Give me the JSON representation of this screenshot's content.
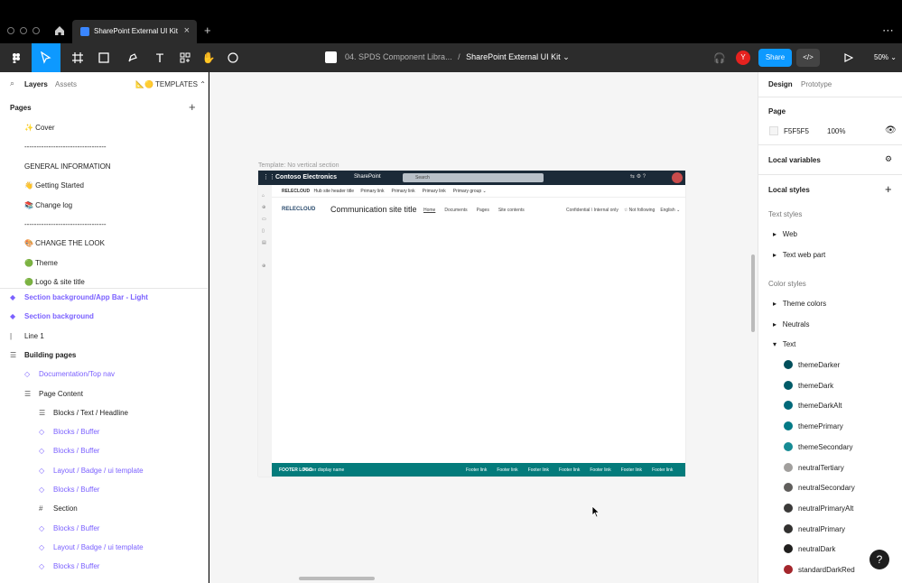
{
  "browser": {
    "tab_title": "SharePoint External UI Kit",
    "new_tab": "+",
    "close": "×",
    "more": "⋯"
  },
  "toolbar": {
    "breadcrumb_project": "04. SPDS Component Libra...",
    "breadcrumb_sep": "/",
    "breadcrumb_file": "SharePoint External UI Kit",
    "avatar": "Y",
    "share_label": "Share",
    "dev_label": "</>",
    "zoom": "50%"
  },
  "left": {
    "tab_layers": "Layers",
    "tab_assets": "Assets",
    "templates": "TEMPLATES",
    "pages_header": "Pages",
    "pages": [
      {
        "label": "✨ Cover"
      },
      {
        "label": "----------------------------------"
      },
      {
        "label": "GENERAL INFORMATION"
      },
      {
        "label": "👋 Getting Started"
      },
      {
        "label": "📚 Change log"
      },
      {
        "label": "----------------------------------"
      },
      {
        "label": "🎨 CHANGE THE LOOK"
      },
      {
        "label": "🟢 Theme"
      },
      {
        "label": "🟢 Logo & site title"
      }
    ],
    "layers": [
      {
        "label": "Section background/App Bar - Light",
        "color": "#7b61ff",
        "bold": true,
        "indent": 0,
        "icon": "◆"
      },
      {
        "label": "Section background",
        "color": "#7b61ff",
        "bold": true,
        "indent": 0,
        "icon": "◆"
      },
      {
        "label": "Line 1",
        "color": "#1e1e1e",
        "bold": false,
        "indent": 0,
        "icon": "|"
      },
      {
        "label": "Building pages",
        "color": "#1e1e1e",
        "bold": true,
        "indent": 0,
        "icon": "☰"
      },
      {
        "label": "Documentation/Top nav",
        "color": "#7b61ff",
        "bold": false,
        "indent": 1,
        "icon": "◇"
      },
      {
        "label": "Page Content",
        "color": "#1e1e1e",
        "bold": false,
        "indent": 1,
        "icon": "☰"
      },
      {
        "label": "Blocks / Text / Headline",
        "color": "#1e1e1e",
        "bold": false,
        "indent": 2,
        "icon": "☰"
      },
      {
        "label": "Blocks / Buffer",
        "color": "#7b61ff",
        "bold": false,
        "indent": 2,
        "icon": "◇"
      },
      {
        "label": "Blocks / Buffer",
        "color": "#7b61ff",
        "bold": false,
        "indent": 2,
        "icon": "◇"
      },
      {
        "label": "Layout / Badge / ui template",
        "color": "#7b61ff",
        "bold": false,
        "indent": 2,
        "icon": "◇"
      },
      {
        "label": "Blocks / Buffer",
        "color": "#7b61ff",
        "bold": false,
        "indent": 2,
        "icon": "◇"
      },
      {
        "label": "Section",
        "color": "#1e1e1e",
        "bold": false,
        "indent": 2,
        "icon": "#"
      },
      {
        "label": "Blocks / Buffer",
        "color": "#7b61ff",
        "bold": false,
        "indent": 2,
        "icon": "◇"
      },
      {
        "label": "Layout / Badge / ui template",
        "color": "#7b61ff",
        "bold": false,
        "indent": 2,
        "icon": "◇"
      },
      {
        "label": "Blocks / Buffer",
        "color": "#7b61ff",
        "bold": false,
        "indent": 2,
        "icon": "◇"
      }
    ]
  },
  "canvas": {
    "frame_label": "Template: No vertical section",
    "sp": {
      "org": "Contoso Electronics",
      "app": "SharePoint",
      "search": "Search",
      "hub_logo": "RELECLOUD",
      "hub_title": "Hub site header title",
      "hub_links": [
        "Primary link",
        "Primary link",
        "Primary link",
        "Primary group ⌄"
      ],
      "site_logo": "RELECLOUD",
      "site_title": "Communication site title",
      "site_nav": [
        "Home",
        "Documents",
        "Pages",
        "Site contents"
      ],
      "site_meta": [
        "Confidential \\ Internal only",
        "☆ Not following",
        "English ⌄"
      ],
      "footer_logo": "FOOTER LOGO",
      "footer_name": "Footer display name",
      "footer_links": [
        "Footer link",
        "Footer link",
        "Footer link",
        "Footer link",
        "Footer link",
        "Footer link",
        "Footer link"
      ]
    }
  },
  "right": {
    "tab_design": "Design",
    "tab_prototype": "Prototype",
    "page_header": "Page",
    "page_color": "F5F5F5",
    "page_opacity": "100%",
    "local_variables": "Local variables",
    "local_styles": "Local styles",
    "text_styles": "Text styles",
    "text_style_groups": [
      "Web",
      "Text web part"
    ],
    "color_styles": "Color styles",
    "color_groups": [
      "Theme colors",
      "Neutrals"
    ],
    "text_group": "Text",
    "swatches": [
      {
        "name": "themeDarker",
        "color": "#004e5b"
      },
      {
        "name": "themeDark",
        "color": "#005b68"
      },
      {
        "name": "themeDarkAlt",
        "color": "#00697a"
      },
      {
        "name": "themePrimary",
        "color": "#037a86"
      },
      {
        "name": "themeSecondary",
        "color": "#168b94"
      },
      {
        "name": "neutralTertiary",
        "color": "#a19f9d"
      },
      {
        "name": "neutralSecondary",
        "color": "#605e5c"
      },
      {
        "name": "neutralPrimaryAlt",
        "color": "#3b3a39"
      },
      {
        "name": "neutralPrimary",
        "color": "#323130"
      },
      {
        "name": "neutralDark",
        "color": "#201f1e"
      },
      {
        "name": "standardDarkRed",
        "color": "#a4262c"
      }
    ]
  },
  "help": "?"
}
